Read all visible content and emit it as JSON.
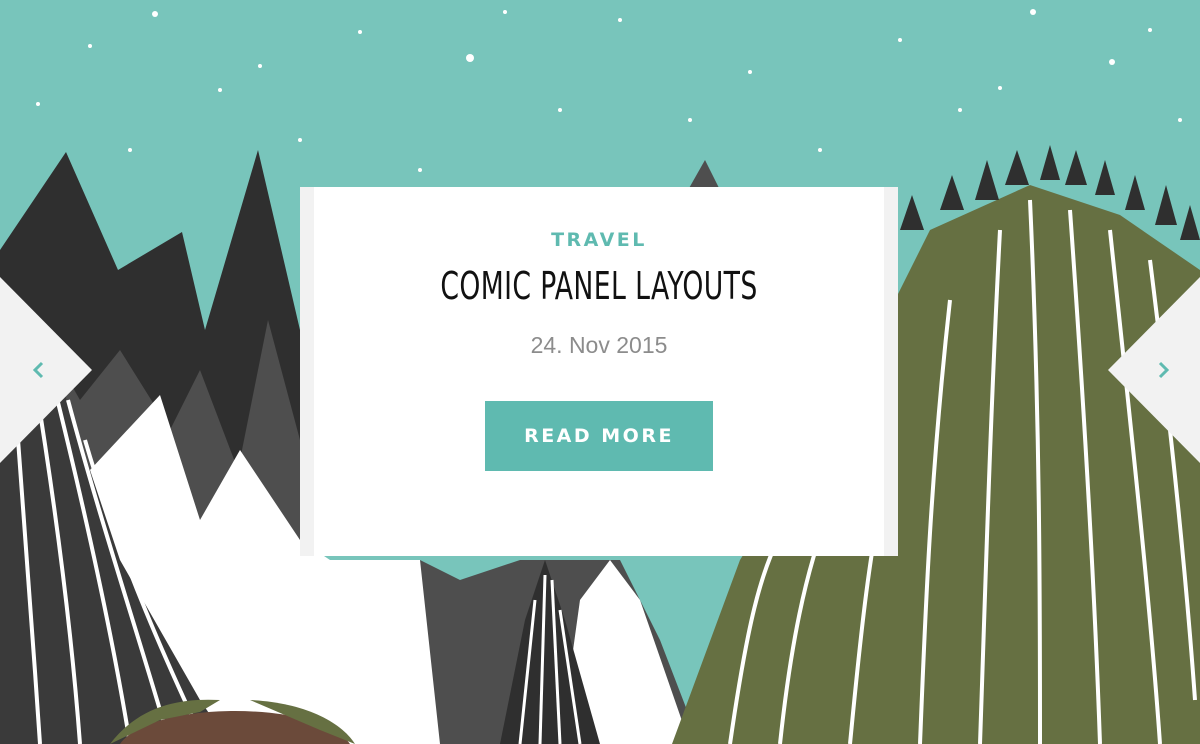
{
  "slide": {
    "category": "TRAVEL",
    "title": "COMIC PANEL LAYOUTS",
    "date": "24. Nov 2015",
    "button_label": "READ MORE"
  },
  "navigation": {
    "prev_icon": "chevron-left-icon",
    "next_icon": "chevron-right-icon"
  },
  "colors": {
    "accent": "#5fbab0",
    "sky": "#78c5bb",
    "dark_mountain": "#2f2f2f",
    "mid_mountain": "#4e4e4e",
    "hill": "#667042",
    "snow": "#ffffff",
    "nav_bg": "#f2f2f2"
  }
}
